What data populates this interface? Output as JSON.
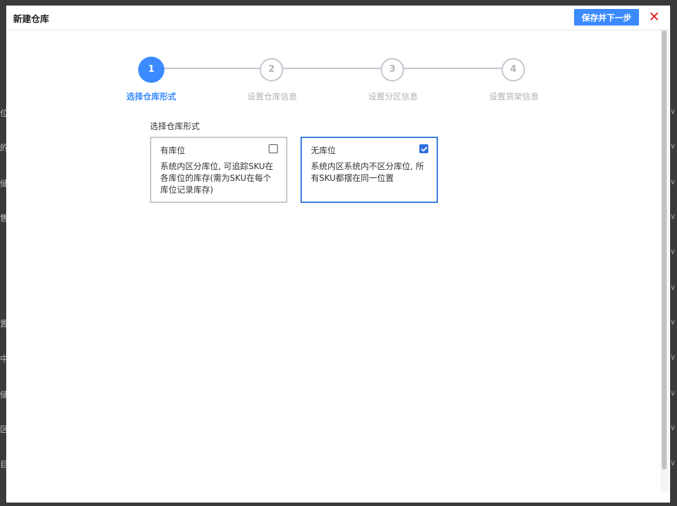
{
  "modal": {
    "title": "新建仓库",
    "save_next_label": "保存并下一步",
    "close_glyph": "✕",
    "close_color": "#e02020",
    "accent_color": "#3b8bff"
  },
  "stepper": {
    "steps": [
      {
        "number": "1",
        "label": "选择仓库形式",
        "active": true
      },
      {
        "number": "2",
        "label": "设置仓库信息",
        "active": false
      },
      {
        "number": "3",
        "label": "设置分区信息",
        "active": false
      },
      {
        "number": "4",
        "label": "设置货架信息",
        "active": false
      }
    ]
  },
  "form": {
    "section_label": "选择仓库形式",
    "options": [
      {
        "title": "有库位",
        "description": "系统内区分库位, 可追踪SKU在各库位的库存(需为SKU在每个库位记录库存)",
        "checked": false
      },
      {
        "title": "无库位",
        "description": "系统内区系统内不区分库位, 所有SKU都摆在同一位置",
        "checked": true
      }
    ]
  },
  "background": {
    "left_glyphs": [
      "位",
      "的",
      "储",
      "售",
      "置",
      "中",
      "储",
      "区",
      "目"
    ],
    "right_glyph": "∨"
  }
}
